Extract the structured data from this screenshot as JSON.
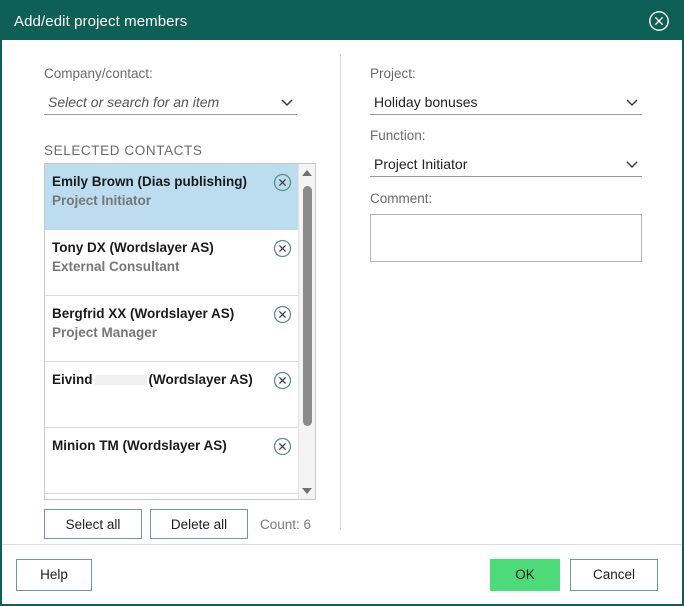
{
  "window": {
    "title": "Add/edit project members",
    "close_icon": "close-circle-icon",
    "accent_color": "#0e6056",
    "ok_color": "#4ddb7a",
    "selection_color": "#bcdcef"
  },
  "left_panel": {
    "company_label": "Company/contact:",
    "company_placeholder": "Select or search for an item",
    "company_value": "",
    "company_chevron_icon": "chevron-down-icon",
    "selected_contacts_label": "SELECTED CONTACTS",
    "contacts": [
      {
        "name": "Emily Brown (Dias publishing)",
        "role": "Project Initiator",
        "selected": true,
        "redacted": false,
        "remove_icon": "remove-circle-icon"
      },
      {
        "name": "Tony DX (Wordslayer AS)",
        "role": "External Consultant",
        "selected": false,
        "redacted": false,
        "remove_icon": "remove-circle-icon"
      },
      {
        "name": "Bergfrid XX (Wordslayer AS)",
        "role": "Project Manager",
        "selected": false,
        "redacted": false,
        "remove_icon": "remove-circle-icon"
      },
      {
        "name_prefix": "Eivind",
        "name_suffix": "(Wordslayer AS)",
        "name": "Eivind (Wordslayer AS)",
        "role": "",
        "selected": false,
        "redacted": true,
        "remove_icon": "remove-circle-icon"
      },
      {
        "name": "Minion TM (Wordslayer AS)",
        "role": "",
        "selected": false,
        "redacted": false,
        "remove_icon": "remove-circle-icon"
      }
    ],
    "select_all_label": "Select all",
    "delete_all_label": "Delete all",
    "count_label": "Count: 6",
    "scrollbar": {
      "up_icon": "scroll-up-arrow-icon",
      "down_icon": "scroll-down-arrow-icon"
    }
  },
  "right_panel": {
    "project_label": "Project:",
    "project_value": "Holiday bonuses",
    "project_chevron_icon": "chevron-down-icon",
    "function_label": "Function:",
    "function_value": "Project Initiator",
    "function_chevron_icon": "chevron-down-icon",
    "comment_label": "Comment:",
    "comment_value": ""
  },
  "footer": {
    "help_label": "Help",
    "ok_label": "OK",
    "cancel_label": "Cancel"
  }
}
